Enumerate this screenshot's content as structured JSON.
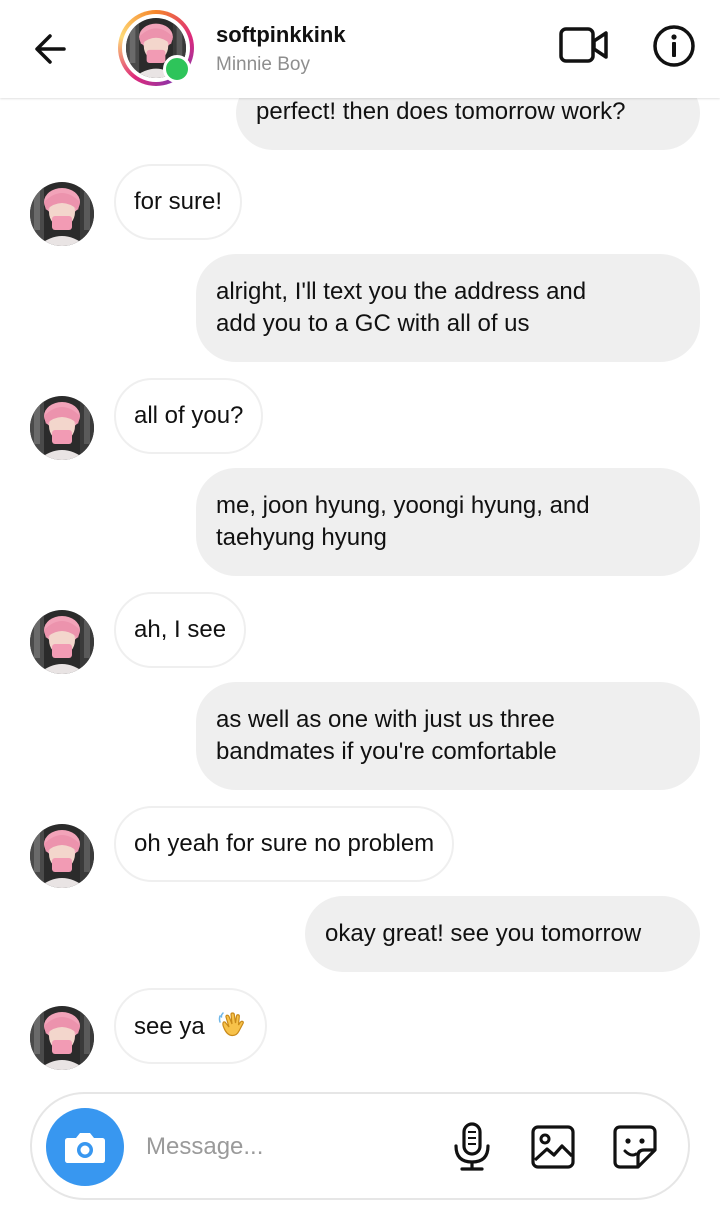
{
  "header": {
    "username": "softpinkkink",
    "display_name": "Minnie Boy",
    "back_icon": "back-arrow-icon",
    "video_icon": "video-camera-icon",
    "info_icon": "info-icon"
  },
  "messages": [
    {
      "from": "me",
      "text": "perfect! then does tomorrow work?"
    },
    {
      "from": "them",
      "text": "for sure!"
    },
    {
      "from": "me",
      "lines": [
        "alright, I'll text you the address and",
        "add you to a GC with all of us"
      ]
    },
    {
      "from": "them",
      "text": "all of you?"
    },
    {
      "from": "me",
      "lines": [
        "me, joon hyung, yoongi hyung, and",
        "taehyung hyung"
      ]
    },
    {
      "from": "them",
      "text": "ah, I see"
    },
    {
      "from": "me",
      "lines": [
        "as well as one with just us three",
        "bandmates if you're comfortable"
      ]
    },
    {
      "from": "them",
      "text": "oh yeah for sure no problem"
    },
    {
      "from": "me",
      "text": "okay great! see you tomorrow"
    },
    {
      "from": "them",
      "text": "see ya",
      "emoji": "waving-hand-icon"
    }
  ],
  "composer": {
    "placeholder": "Message...",
    "camera_icon": "camera-icon",
    "mic_icon": "microphone-icon",
    "gallery_icon": "gallery-icon",
    "sticker_icon": "sticker-icon"
  },
  "colors": {
    "accent": "#3897f0",
    "online": "#2ec45a",
    "sent_bubble": "#efefef",
    "recv_border": "#efefef"
  }
}
